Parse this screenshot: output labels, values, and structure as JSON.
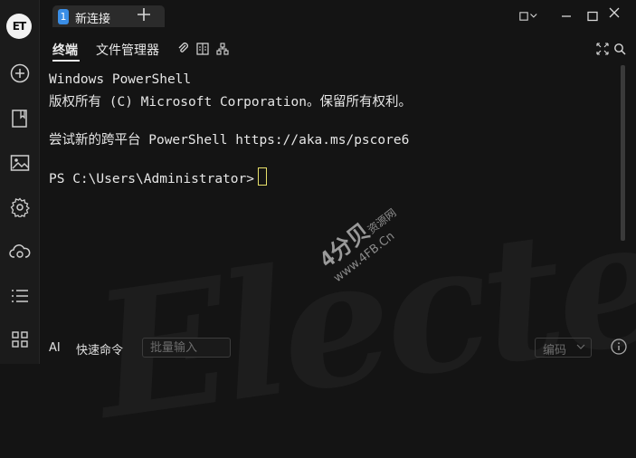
{
  "app": {
    "logo_text": "ET"
  },
  "tab": {
    "number": "1",
    "label": "新连接"
  },
  "toolbar": {
    "terminal_tab": "终端",
    "file_manager_tab": "文件管理器"
  },
  "terminal": {
    "lines": [
      "Windows PowerShell",
      "版权所有 (C) Microsoft Corporation。保留所有权利。",
      "",
      "尝试新的跨平台 PowerShell https://aka.ms/pscore6",
      "",
      "PS C:\\Users\\Administrator>"
    ],
    "watermark_big": "Electerm",
    "watermark_brand": "4分贝",
    "watermark_sub": "资源网",
    "watermark_url": "www.4FB.Cn"
  },
  "bottom": {
    "ai_label": "AI",
    "quick_cmd_label": "快速命令",
    "batch_placeholder": "批量输入",
    "encoding_label": "编码"
  },
  "colors": {
    "accent": "#3a8ee6",
    "status_green": "#31c48d",
    "background": "#141414",
    "cursor": "#e8e06a"
  }
}
